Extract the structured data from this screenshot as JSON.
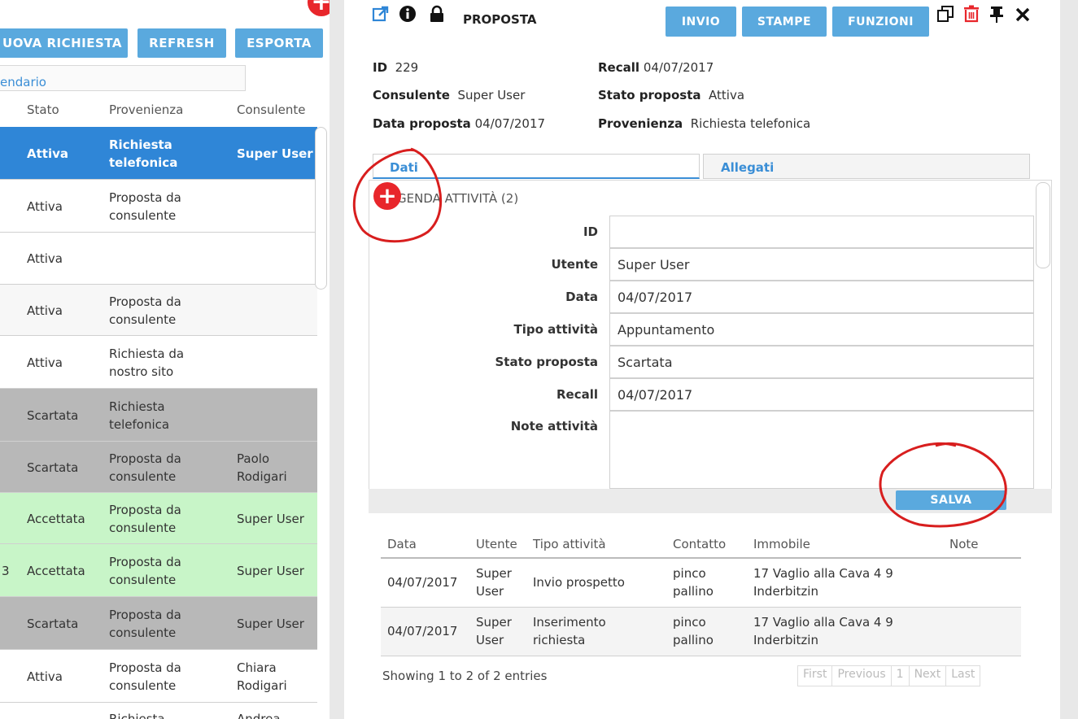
{
  "left": {
    "buttons": {
      "new": "UOVA RICHIESTA",
      "refresh": "REFRESH",
      "export": "ESPORTA"
    },
    "add_symbol": "+",
    "tab_label": "endario",
    "columns": {
      "stato": "Stato",
      "provenienza": "Provenienza",
      "consulente": "Consulente"
    },
    "rows": [
      {
        "id": "",
        "stato": "Attiva",
        "prov1": "Richiesta",
        "prov2": "telefonica",
        "cons1": "Super User",
        "cons2": ""
      },
      {
        "id": "",
        "stato": "Attiva",
        "prov1": "Proposta da",
        "prov2": "consulente",
        "cons1": "",
        "cons2": ""
      },
      {
        "id": "",
        "stato": "Attiva",
        "prov1": "",
        "prov2": "",
        "cons1": "",
        "cons2": ""
      },
      {
        "id": "",
        "stato": "Attiva",
        "prov1": "Proposta da",
        "prov2": "consulente",
        "cons1": "",
        "cons2": ""
      },
      {
        "id": "",
        "stato": "Attiva",
        "prov1": "Richiesta da",
        "prov2": "nostro sito",
        "cons1": "",
        "cons2": ""
      },
      {
        "id": "",
        "stato": "Scartata",
        "prov1": "Richiesta",
        "prov2": "telefonica",
        "cons1": "",
        "cons2": ""
      },
      {
        "id": "",
        "stato": "Scartata",
        "prov1": "Proposta da",
        "prov2": "consulente",
        "cons1": "Paolo",
        "cons2": "Rodigari"
      },
      {
        "id": "",
        "stato": "Accettata",
        "prov1": "Proposta da",
        "prov2": "consulente",
        "cons1": "Super User",
        "cons2": ""
      },
      {
        "id": "3",
        "stato": "Accettata",
        "prov1": "Proposta da",
        "prov2": "consulente",
        "cons1": "Super User",
        "cons2": ""
      },
      {
        "id": "",
        "stato": "Scartata",
        "prov1": "Proposta da",
        "prov2": "consulente",
        "cons1": "Super User",
        "cons2": ""
      },
      {
        "id": "",
        "stato": "Attiva",
        "prov1": "Proposta da",
        "prov2": "consulente",
        "cons1": "Chiara",
        "cons2": "Rodigari"
      },
      {
        "id": "",
        "stato": "",
        "prov1": "Richiesta",
        "prov2": "",
        "cons1": "Andrea",
        "cons2": ""
      }
    ]
  },
  "header": {
    "title": "PROPOSTA",
    "buttons": {
      "invio": "INVIO",
      "stampe": "STAMPE",
      "funzioni": "FUNZIONI"
    },
    "icons": {
      "edit": "✎",
      "info": "i",
      "lock": "lock",
      "copy": "⧉",
      "delete": "trash",
      "pin": "pin",
      "close": "✖"
    }
  },
  "summary": {
    "id_label": "ID",
    "id_value": "229",
    "recall_label": "Recall",
    "recall_value": "04/07/2017",
    "consulente_label": "Consulente",
    "consulente_value": "Super User",
    "stato_label": "Stato proposta",
    "stato_value": "Attiva",
    "data_label": "Data proposta",
    "data_value": "04/07/2017",
    "prov_label": "Provenienza",
    "prov_value": "Richiesta telefonica"
  },
  "tabs": {
    "dati": "Dati",
    "allegati": "Allegati"
  },
  "agenda": {
    "title": "AGENDA ATTIVITÀ (2)",
    "add_symbol": "+",
    "fields": {
      "id_label": "ID",
      "id_value": "",
      "utente_label": "Utente",
      "utente_value": "Super User",
      "data_label": "Data",
      "data_value": "04/07/2017",
      "tipo_label": "Tipo attività",
      "tipo_value": "Appuntamento",
      "stato_label": "Stato proposta",
      "stato_value": "Scartata",
      "recall_label": "Recall",
      "recall_value": "04/07/2017",
      "note_label": "Note attività",
      "note_value": ""
    },
    "save_label": "SALVA"
  },
  "activities": {
    "columns": {
      "data": "Data",
      "utente": "Utente",
      "tipo": "Tipo attività",
      "contatto": "Contatto",
      "immobile": "Immobile",
      "note": "Note"
    },
    "rows": [
      {
        "data": "04/07/2017",
        "utente1": "Super",
        "utente2": "User",
        "tipo1": "Invio prospetto",
        "tipo2": "",
        "contatto1": "pinco",
        "contatto2": "pallino",
        "immobile1": "17 Vaglio alla Cava 4 9",
        "immobile2": "Inderbitzin",
        "note": ""
      },
      {
        "data": "04/07/2017",
        "utente1": "Super",
        "utente2": "User",
        "tipo1": "Inserimento",
        "tipo2": "richiesta",
        "contatto1": "pinco",
        "contatto2": "pallino",
        "immobile1": "17 Vaglio alla Cava 4 9",
        "immobile2": "Inderbitzin",
        "note": ""
      }
    ],
    "footer": "Showing 1 to 2 of 2 entries",
    "pager": {
      "first": "First",
      "previous": "Previous",
      "page": "1",
      "next": "Next",
      "last": "Last"
    }
  },
  "colors": {
    "accent": "#5aa9de",
    "selected_row": "#2f86d7",
    "discarded_row": "#b8b8b8",
    "accepted_row": "#c8f5c8",
    "add_button": "#e8262b",
    "annotation": "#d81e1e"
  }
}
